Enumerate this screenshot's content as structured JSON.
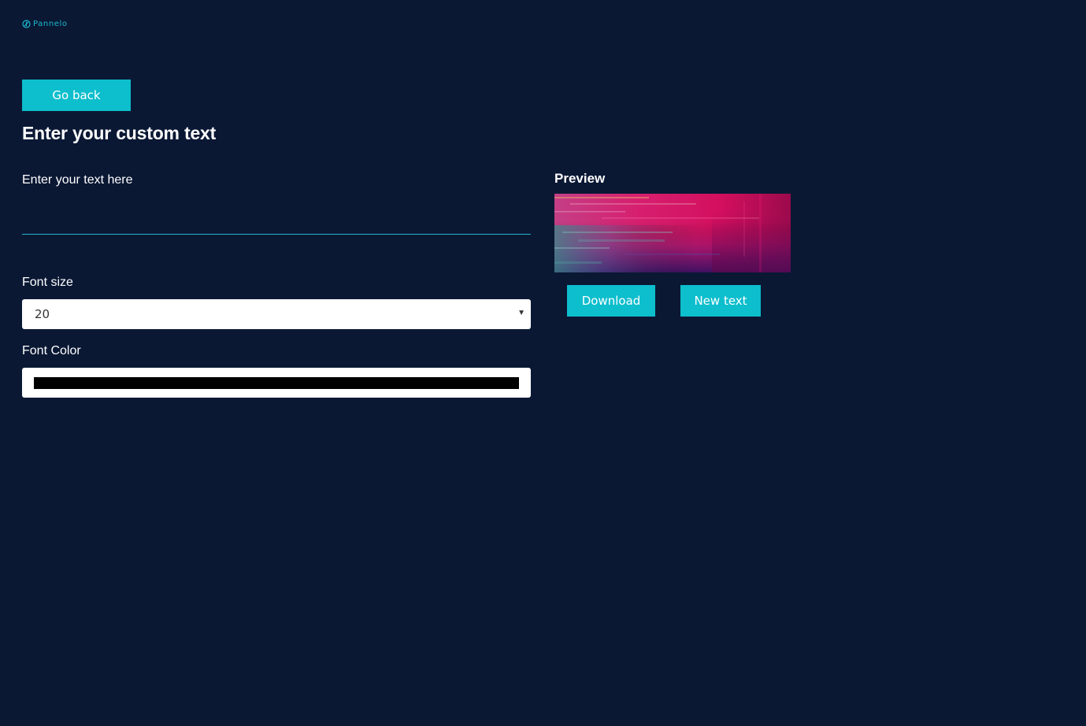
{
  "brand": {
    "name": "Pannelo",
    "icon": "pannelo-logo-icon",
    "color": "#1ab9cf"
  },
  "theme": {
    "background": "#0a1834",
    "accent": "#0dbecd"
  },
  "nav": {
    "go_back_label": "Go back"
  },
  "form": {
    "title": "Enter your custom text",
    "text_label": "Enter your text here",
    "text_value": "",
    "font_size_label": "Font size",
    "font_size_value": "20",
    "font_color_label": "Font Color",
    "font_color_value": "#000000"
  },
  "preview": {
    "title": "Preview",
    "image": "glitch-gradient-background-image",
    "download_label": "Download",
    "new_text_label": "New text"
  }
}
